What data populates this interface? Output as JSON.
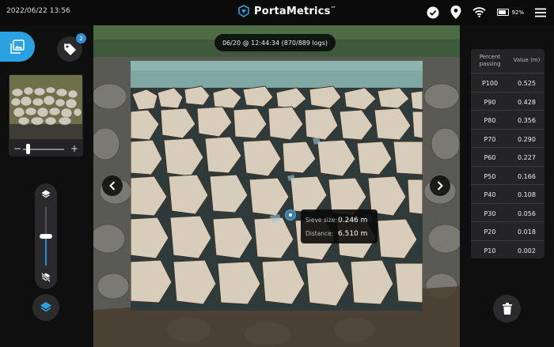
{
  "topbar": {
    "datetime": "2022/06/22 13:56",
    "brand": "PortaMetrics",
    "brand_tm": "™",
    "battery_pct": "92%"
  },
  "icons": {
    "logo": "portametrics-logo-icon",
    "check": "check-circle-icon",
    "location": "location-pin-icon",
    "wifi": "wifi-icon",
    "battery": "battery-icon",
    "menu": "hamburger-menu-icon",
    "gallery": "image-gallery-icon",
    "tag": "tag-icon",
    "layers": "layers-icon",
    "layers_off": "layers-off-icon",
    "prev": "chevron-left-icon",
    "next": "chevron-right-icon",
    "trash": "trash-icon"
  },
  "sidebar": {
    "tag_badge": "2",
    "zoom_minus": "−",
    "zoom_plus": "+",
    "opacity_level": 0.5
  },
  "viewer": {
    "log_label": "06/20 @ 12:44:34 (870/889 logs)",
    "tooltip": {
      "sieve_label": "Sieve size:",
      "sieve_value": "0.246 m",
      "distance_label": "Distance:",
      "distance_value": "6.510 m"
    }
  },
  "table": {
    "headers": [
      "Percent passing",
      "Value (m)"
    ],
    "rows": [
      {
        "percent": "P100",
        "value": "0.525"
      },
      {
        "percent": "P90",
        "value": "0.428"
      },
      {
        "percent": "P80",
        "value": "0.356"
      },
      {
        "percent": "P70",
        "value": "0.290"
      },
      {
        "percent": "P60",
        "value": "0.227"
      },
      {
        "percent": "P50",
        "value": "0.166"
      },
      {
        "percent": "P40",
        "value": "0.108"
      },
      {
        "percent": "P30",
        "value": "0.056"
      },
      {
        "percent": "P20",
        "value": "0.018"
      },
      {
        "percent": "P10",
        "value": "0.002"
      }
    ]
  },
  "colors": {
    "accent": "#2aa1e1",
    "panel": "#0f0f10",
    "card": "#242426",
    "rock_fill": "#d8ccbb",
    "rock_outline": "#3a3328"
  }
}
